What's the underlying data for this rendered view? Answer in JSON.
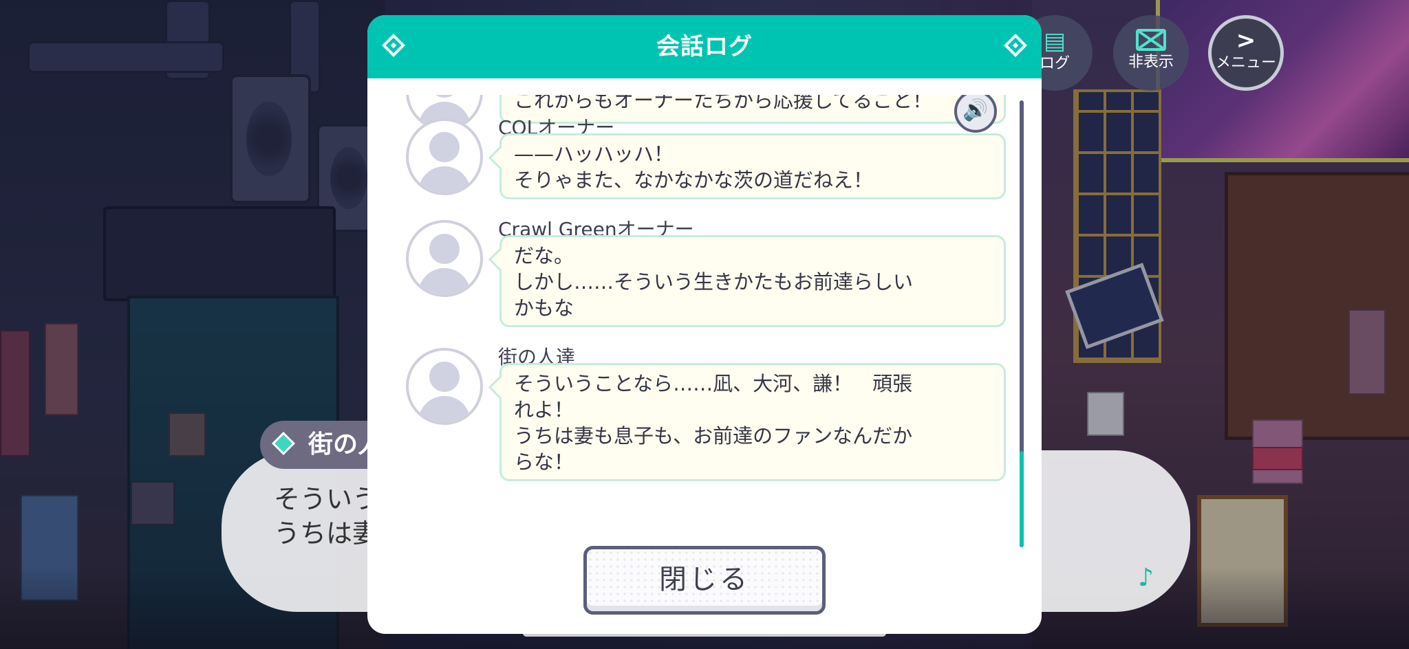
{
  "modal": {
    "title": "会話ログ",
    "close_label": "閉じる"
  },
  "top_buttons": {
    "log_label": "ログ",
    "hide_label": "非表示",
    "menu_label": "メニュー",
    "menu_glyph": ">"
  },
  "log_entries": [
    {
      "speaker": "",
      "lines": [
        "これからもオーナーたちから応援してること！"
      ],
      "has_voice": true,
      "partially_visible": true
    },
    {
      "speaker": "COLオーナー",
      "lines": [
        "——ハッハッハ！",
        "そりゃまた、なかなかな茨の道だねえ！"
      ],
      "has_voice": false
    },
    {
      "speaker": "Crawl Greenオーナー",
      "lines": [
        "だな。",
        "しかし……そういう生きかたもお前達らしい",
        "かもな"
      ],
      "has_voice": false
    },
    {
      "speaker": "街の人達",
      "lines": [
        "そういうことなら……凪、大河、謙！　頑張",
        "れよ！",
        "うちは妻も息子も、お前達のファンなんだか",
        "らな！"
      ],
      "has_voice": false
    }
  ],
  "game_dialog": {
    "speaker": "街の人",
    "line1": "そういう",
    "line2": "うちは妻"
  },
  "icons": {
    "voice": "speaker-icon",
    "music": "music-note-icon",
    "avatar": "avatar-placeholder-icon"
  },
  "colors": {
    "accent": "#00c4b2",
    "bubble_bg": "#fffef0",
    "bubble_border": "#c6ecde",
    "text": "#353545"
  }
}
